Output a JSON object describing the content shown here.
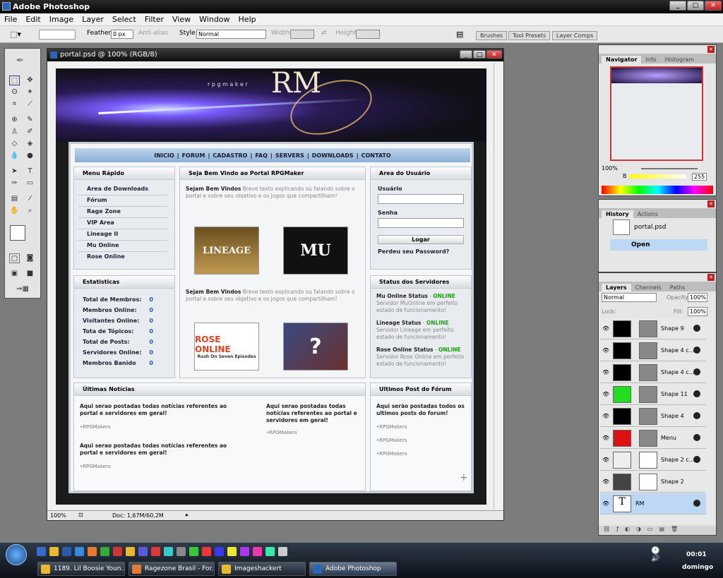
{
  "app": {
    "title": "Adobe Photoshop"
  },
  "menu": [
    "File",
    "Edit",
    "Image",
    "Layer",
    "Select",
    "Filter",
    "View",
    "Window",
    "Help"
  ],
  "options": {
    "feather_label": "Feather:",
    "feather_value": "0 px",
    "antialias": "Anti-alias",
    "style_label": "Style:",
    "style_value": "Normal",
    "width_label": "Width:",
    "height_label": "Height:",
    "wells": [
      "Brushes",
      "Tool Presets",
      "Layer Comps"
    ]
  },
  "document": {
    "title": "portal.psd @ 100% (RGB/8)",
    "zoom": "100%",
    "doc_info": "Doc: 1,67M/60,2M"
  },
  "site": {
    "logo_sub": "r p g  m a k e r",
    "logo": "RM",
    "nav": [
      "INICIO",
      "FORUM",
      "CADASTRO",
      "FAQ",
      "SERVERS",
      "DOWNLOADS",
      "CONTATO"
    ],
    "menu_title": "Menu Rápido",
    "menu_items": [
      "Area de Downloads",
      "Fórum",
      "Rage Zone",
      "VIP Area",
      "Lineage II",
      "Mu Online",
      "Rose Online"
    ],
    "stats_title": "Estatisticas",
    "stats": [
      {
        "label": "Total de Membros:",
        "value": "0"
      },
      {
        "label": "Membros Online:",
        "value": "0"
      },
      {
        "label": "Visitantes Online:",
        "value": "0"
      },
      {
        "label": "Tota de Tópicos:",
        "value": "0"
      },
      {
        "label": "Total de Posts:",
        "value": "0"
      },
      {
        "label": "Servidores Online:",
        "value": "0"
      },
      {
        "label": "Membros Banido",
        "value": "0"
      }
    ],
    "welcome_title": "Seja Bem Vindo ao Portal RPGMaker",
    "welcome_bold": "Sejam Bem Vindos",
    "welcome_text": "Breve texto explicando ou falando sobre o portal e sobre seu objetivo e os jogos que compartilham!",
    "games": [
      "LINEAGE",
      "MU",
      "ROSE ONLINE",
      "?"
    ],
    "rose_sub": "Rush On Seven Episodes",
    "user_title": "Area do Usuário",
    "user_label": "Usuário",
    "pass_label": "Senha",
    "login_btn": "Logar",
    "forgot": "Perdeu seu Password?",
    "servers_title": "Status dos Servidores",
    "servers": [
      {
        "name": "Mu Online Status",
        "status": "ONLINE",
        "desc": "Servidor MuOnline em perfeito estado de funcionamento!"
      },
      {
        "name": "Lineage Status",
        "status": "ONLINE",
        "desc": "Servidor Lineage em perfeito estado de funcionamento!"
      },
      {
        "name": "Rose Online Status",
        "status": "ONLINE",
        "desc": "Servidor Rose Online em perfeito estado de funcionamento!"
      }
    ],
    "news_title": "Últimas Notícias",
    "news_text": "Aqui serao postadas todas notícias referentes ao portal e servidores em geral!",
    "news_author": "•RPGMakers",
    "forum_title": "Ultimos Post do Fórum",
    "forum_text": "Aqui serão postadas todos os ultimos posts do forum!",
    "forum_author": "•RPGMakers"
  },
  "navigator": {
    "tabs": [
      "Navigator",
      "Info",
      "Histogram"
    ],
    "zoom": "100%"
  },
  "color": {
    "channel": "B",
    "value": "255"
  },
  "history": {
    "tabs": [
      "History",
      "Actions"
    ],
    "file": "portal.psd",
    "state": "Open"
  },
  "layers": {
    "tabs": [
      "Layers",
      "Channels",
      "Paths"
    ],
    "blend": "Normal",
    "opacity_label": "Opacity:",
    "opacity": "100%",
    "lock_label": "Lock:",
    "fill_label": "Fill:",
    "fill": "100%",
    "items": [
      {
        "name": "Shape 9",
        "thumb": "#000000"
      },
      {
        "name": "Shape 4 c...",
        "thumb": "#000000"
      },
      {
        "name": "Shape 4 c...",
        "thumb": "#000000"
      },
      {
        "name": "Shape 11",
        "thumb": "#22dd22"
      },
      {
        "name": "Shape 4",
        "thumb": "#000000"
      },
      {
        "name": "Menu",
        "thumb": "#dd1111"
      },
      {
        "name": "Shape 2 c...",
        "thumb": "#eeeeee"
      },
      {
        "name": "Shape 2",
        "thumb": "#444444"
      },
      {
        "name": "RM",
        "thumb": "#ffffff"
      }
    ]
  },
  "taskbar": {
    "tasks": [
      "1189. Lil Boosie Youn...",
      "Ragezone Brasil - For...",
      "Imageshackert",
      "Adobe Photoshop"
    ],
    "time": "00:01",
    "day": "domingo"
  }
}
